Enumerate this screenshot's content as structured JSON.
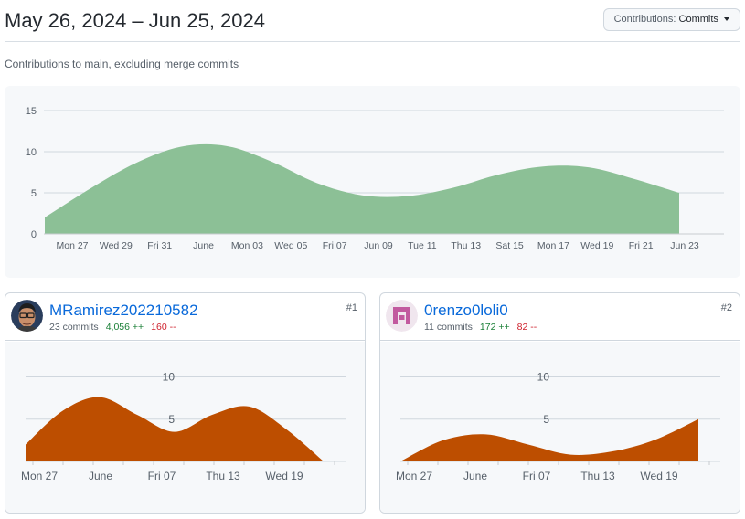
{
  "header": {
    "title": "May 26, 2024 – Jun 25, 2024",
    "dropdown_label": "Contributions:",
    "dropdown_value": "Commits"
  },
  "subtitle": "Contributions to main, excluding merge commits",
  "colors": {
    "main_fill": "#8cc096",
    "contributor_fill": "#bd4e00",
    "link": "#0969da",
    "additions": "#1a7f37",
    "deletions": "#cf222e"
  },
  "chart_data": [
    {
      "type": "area",
      "title": "",
      "x_labels": [
        "Mon 27",
        "Wed 29",
        "Fri 31",
        "June",
        "Mon 03",
        "Wed 05",
        "Fri 07",
        "Jun 09",
        "Tue 11",
        "Thu 13",
        "Sat 15",
        "Mon 17",
        "Wed 19",
        "Fri 21",
        "Jun 23"
      ],
      "y_ticks": [
        0,
        5,
        10,
        15
      ],
      "ylim": [
        0,
        15
      ],
      "series": [
        {
          "values": [
            2,
            5.5,
            8.6,
            10.6,
            10.7,
            8.8,
            6.2,
            4.7,
            4.6,
            5.6,
            7.2,
            8.2,
            8.1,
            6.7,
            5
          ]
        }
      ]
    },
    {
      "type": "area",
      "title": "",
      "x_labels": [
        "Mon 27",
        "June",
        "Fri 07",
        "Thu 13",
        "Wed 19"
      ],
      "y_ticks": [
        5,
        10
      ],
      "ylim": [
        0,
        12
      ],
      "series": [
        {
          "values": [
            2,
            6,
            7.6,
            5.5,
            3.5,
            5.5,
            6.5,
            3.8,
            0
          ]
        }
      ]
    },
    {
      "type": "area",
      "title": "",
      "x_labels": [
        "Mon 27",
        "June",
        "Fri 07",
        "Thu 13",
        "Wed 19"
      ],
      "y_ticks": [
        5,
        10
      ],
      "ylim": [
        0,
        12
      ],
      "series": [
        {
          "values": [
            0,
            2.5,
            3.2,
            2,
            0.8,
            1.2,
            2.6,
            5
          ]
        }
      ]
    }
  ],
  "contributors": [
    {
      "name": "MRamirez202210582",
      "commits": "23 commits",
      "additions": "4,056 ++",
      "deletions": "160 --",
      "rank": "#1",
      "avatar_icon": "person-photo-icon"
    },
    {
      "name": "0renzo0loli0",
      "commits": "11 commits",
      "additions": "172 ++",
      "deletions": "82 --",
      "rank": "#2",
      "avatar_icon": "identicon"
    }
  ]
}
